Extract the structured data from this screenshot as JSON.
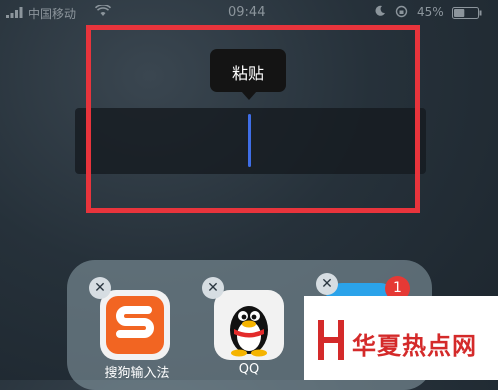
{
  "status_bar": {
    "carrier": "中国移动",
    "time": "09:44",
    "battery_percent": "45%",
    "battery_level": 0.45,
    "icons": [
      "signal-icon",
      "wifi-icon",
      "moon-icon",
      "rotation-lock-icon",
      "battery-icon"
    ]
  },
  "context_menu": {
    "paste_label": "粘贴"
  },
  "folder": {
    "apps": [
      {
        "label": "搜狗输入法",
        "icon": "sogou-input-icon"
      },
      {
        "label": "QQ",
        "icon": "qq-penguin-icon"
      },
      {
        "label": "",
        "icon": "app-icon",
        "badge": "1"
      }
    ],
    "delete_glyph": "✕"
  },
  "watermark": {
    "text": "华夏热点网"
  },
  "colors": {
    "highlight": "#e8343c",
    "cursor": "#3f6ee6",
    "badge": "#e53935",
    "watermark": "#d42a2a"
  }
}
